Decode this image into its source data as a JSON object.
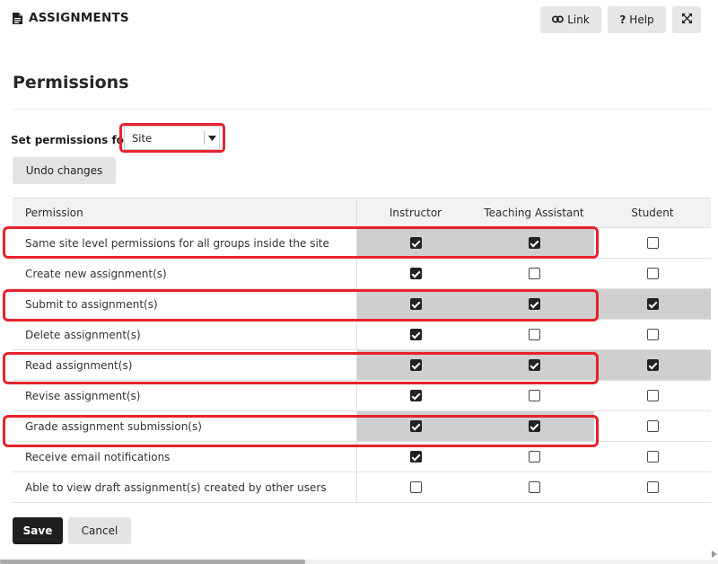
{
  "tool": {
    "title": "ASSIGNMENTS"
  },
  "toolbar": {
    "link_label": "Link",
    "help_label": "Help",
    "help_icon": "?"
  },
  "page": {
    "title": "Permissions"
  },
  "set_permissions": {
    "label": "Set permissions for",
    "selected": "Site"
  },
  "undo_label": "Undo changes",
  "table": {
    "headers": [
      "Permission",
      "Instructor",
      "Teaching Assistant",
      "Student"
    ],
    "rows": [
      {
        "label": "Same site level permissions for all groups inside the site",
        "instructor": true,
        "ta": true,
        "student": false,
        "highlighted": true
      },
      {
        "label": "Create new assignment(s)",
        "instructor": true,
        "ta": false,
        "student": false,
        "highlighted": false
      },
      {
        "label": "Submit to assignment(s)",
        "instructor": true,
        "ta": true,
        "student": true,
        "highlighted": true
      },
      {
        "label": "Delete assignment(s)",
        "instructor": true,
        "ta": false,
        "student": false,
        "highlighted": false
      },
      {
        "label": "Read assignment(s)",
        "instructor": true,
        "ta": true,
        "student": true,
        "highlighted": true
      },
      {
        "label": "Revise assignment(s)",
        "instructor": true,
        "ta": false,
        "student": false,
        "highlighted": false
      },
      {
        "label": "Grade assignment submission(s)",
        "instructor": true,
        "ta": true,
        "student": false,
        "highlighted": true
      },
      {
        "label": "Receive email notifications",
        "instructor": true,
        "ta": false,
        "student": false,
        "highlighted": false
      },
      {
        "label": "Able to view draft assignment(s) created by other users",
        "instructor": false,
        "ta": false,
        "student": false,
        "highlighted": false
      }
    ]
  },
  "actions": {
    "save_label": "Save",
    "cancel_label": "Cancel"
  },
  "colors": {
    "highlight_border": "#e8222b",
    "shaded_cell": "#cfcfcf",
    "save_bg": "#1f1f1f",
    "button_bg": "#e3e3e3"
  },
  "icons": {
    "title": "document-icon",
    "link": "link-icon",
    "help": "question-icon",
    "expand": "expand-icon",
    "select": "caret-down-icon"
  }
}
